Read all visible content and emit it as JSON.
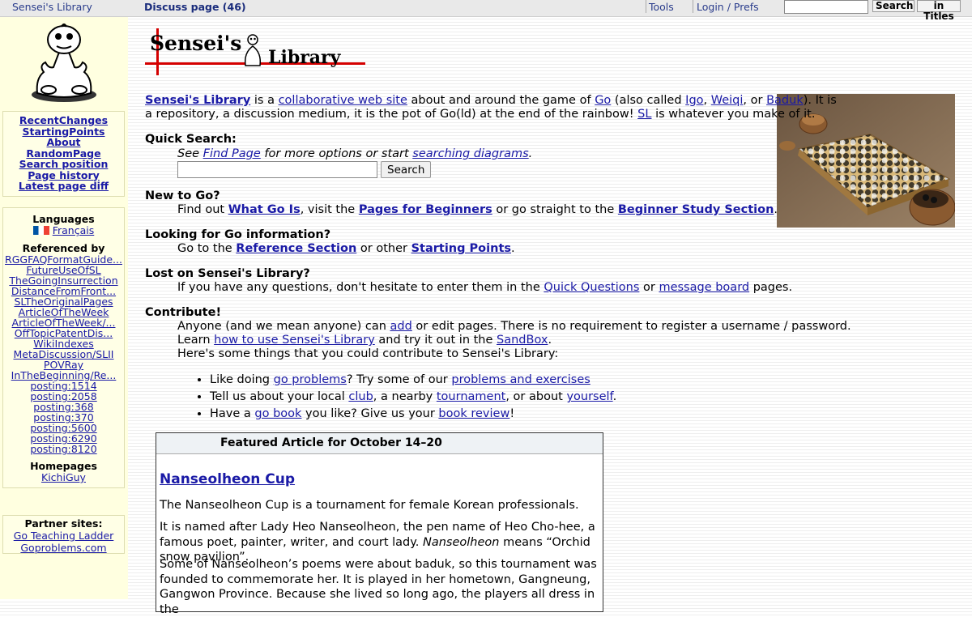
{
  "topbar": {
    "site": "Sensei's Library",
    "discuss": "Discuss page (46)",
    "tools": "Tools",
    "login": "Login / Prefs",
    "search_btn": "Search",
    "titles_btn": "in Titles"
  },
  "sidebar": {
    "nav": [
      "RecentChanges",
      "StartingPoints",
      "About",
      "RandomPage",
      "Search position",
      "Page history",
      "Latest page diff"
    ],
    "languages_heading": "Languages",
    "language": "Français",
    "referenced_heading": "Referenced by",
    "refs": [
      "RGGFAQFormatGuide...",
      "FutureUseOfSL",
      "TheGoingInsurrection",
      "DistanceFromFront...",
      "SLTheOriginalPages",
      "ArticleOfTheWeek",
      "ArticleOfTheWeek/...",
      "OffTopicPatentDis...",
      "WikiIndexes",
      "MetaDiscussion/SLII",
      "POVRay",
      "InTheBeginning/Re...",
      "posting:1514",
      "posting:2058",
      "posting:368",
      "posting:370",
      "posting:5600",
      "posting:6290",
      "posting:8120"
    ],
    "homepages_heading": "Homepages",
    "homepage": "KichiGuy",
    "partner_heading": "Partner sites:",
    "partners": [
      "Go Teaching Ladder",
      "Goproblems.com"
    ]
  },
  "logo": {
    "text_left": "Sensei's",
    "text_right": "Library"
  },
  "intro": {
    "l1": "Sensei's Library",
    "t1": " is a ",
    "l2": "collaborative web site",
    "t2": " about and around the game of ",
    "l3": "Go",
    "t3": " (also called ",
    "l4": "Igo",
    "t4": ", ",
    "l5": "Weiqi",
    "t5": ", or ",
    "l6": "Baduk",
    "t6": "). It is",
    "line2a": "a repository, a discussion medium, it is the pot of Go(ld) at the end of the rainbow! ",
    "l7": "SL",
    "line2b": " is whatever you make of it."
  },
  "quick_search": {
    "heading": "Quick Search:",
    "see": "See ",
    "find_page": "Find Page",
    "mid": " for more options or start ",
    "searching_diagrams": "searching diagrams",
    "end": ".",
    "button": "Search"
  },
  "new_to_go": {
    "heading": "New to Go?",
    "t1": "Find out ",
    "l1": "What Go Is",
    "t2": ", visit the ",
    "l2": "Pages for Beginners",
    "t3": " or go straight to the ",
    "l3": "Beginner Study Section",
    "t4": "."
  },
  "looking": {
    "heading": "Looking for Go information?",
    "t1": "Go to the ",
    "l1": "Reference Section",
    "t2": " or other ",
    "l2": "Starting Points",
    "t3": "."
  },
  "lost": {
    "heading": "Lost on Sensei's Library?",
    "t1": "If you have any questions, don't hesitate to enter them in the ",
    "l1": "Quick Questions",
    "t2": " or ",
    "l2": "message board",
    "t3": " pages."
  },
  "contribute": {
    "heading": "Contribute!",
    "a1": "Anyone (and we mean anyone) can ",
    "add": "add",
    "a2": " or edit pages. There is no requirement to register a username / password.",
    "b1": "Learn ",
    "howto": "how to use Sensei's Library",
    "b2": " and try it out in the ",
    "sandbox": "SandBox",
    "b3": ".",
    "c": "Here's some things that you could contribute to Sensei's Library:",
    "i1a": "Like doing ",
    "i1l": "go problems",
    "i1b": "? Try some of our ",
    "i1l2": "problems and exercises",
    "i2a": "Tell us about your local ",
    "i2l": "club",
    "i2b": ", a nearby ",
    "i2l2": "tournament",
    "i2c": ", or about ",
    "i2l3": "yourself",
    "i2d": ".",
    "i3a": "Have a ",
    "i3l": "go book",
    "i3b": " you like? Give us your ",
    "i3l2": "book review",
    "i3c": "!"
  },
  "featured": {
    "header": "Featured Article for October 14–20",
    "title": "Nanseolheon Cup",
    "p1": "The Nanseolheon Cup is a tournament for female Korean professionals.",
    "p2a": "It is named after Lady Heo Nanseolheon, the pen name of Heo Cho-hee, a famous poet, painter, writer, and court lady. ",
    "p2i": "Nanseolheon",
    "p2b": " means “Orchid snow pavilion”.",
    "p3": "Some of Nanseolheon’s poems were about baduk, so this tournament was founded to commemorate her. It is played in her hometown, Gangneung, Gangwon Province. Because she lived so long ago, the players all dress in the"
  },
  "colors": {
    "link": "#1a1aa6",
    "sidebar_bg": "#ffffe0",
    "logo_red": "#d40000"
  },
  "icons": {
    "mascot": "sensei-mascot",
    "flag": "french-flag",
    "photo": "go-board-photo"
  }
}
